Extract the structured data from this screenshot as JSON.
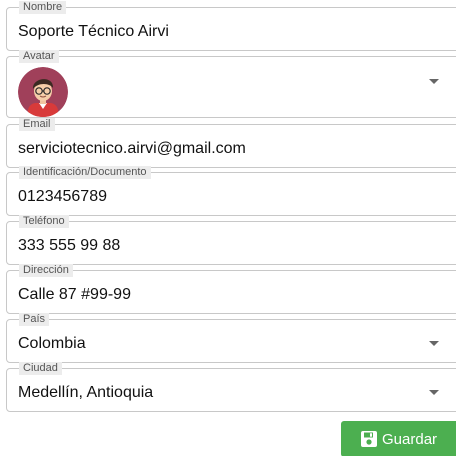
{
  "fields": {
    "nombre": {
      "label": "Nombre",
      "value": "Soporte Técnico Airvi"
    },
    "avatar": {
      "label": "Avatar"
    },
    "email": {
      "label": "Email",
      "value": "serviciotecnico.airvi@gmail.com"
    },
    "identificacion": {
      "label": "Identificación/Documento",
      "value": "0123456789"
    },
    "telefono": {
      "label": "Teléfono",
      "value": "333 555 99 88"
    },
    "direccion": {
      "label": "Dirección",
      "value": "Calle 87 #99-99"
    },
    "pais": {
      "label": "País",
      "value": "Colombia"
    },
    "ciudad": {
      "label": "Ciudad",
      "value": "Medellín, Antioquia"
    }
  },
  "actions": {
    "save_label": "Guardar"
  },
  "colors": {
    "save_button": "#4caf50",
    "avatar_background": "#a0405a"
  }
}
